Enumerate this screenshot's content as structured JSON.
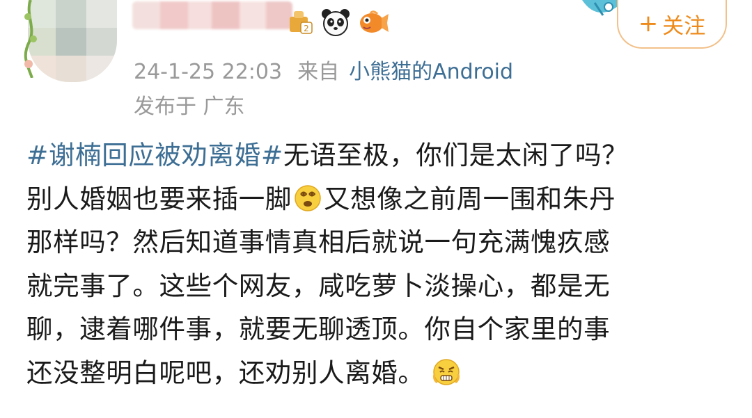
{
  "header": {
    "follow_button": {
      "plus": "+",
      "label": "关注"
    },
    "badges": [
      {
        "icon": "level-badge-icon"
      },
      {
        "icon": "panda-icon"
      },
      {
        "icon": "goldfish-icon"
      }
    ]
  },
  "meta": {
    "timestamp": "24-1-25 22:03",
    "from_label": "来自",
    "source": "小熊猫的Android",
    "location": "发布于 广东"
  },
  "post": {
    "hashtag": "#谢楠回应被劝离婚#",
    "line1_rest": "无语至极，你们是太闲了吗？",
    "line2_a": "别人婚姻也要来插一脚",
    "line2_b": "又想像之前周一围和朱丹",
    "line3": "那样吗？然后知道事情真相后就说一句充满愧疚感",
    "line4": "就完事了。这些个网友，咸吃萝卜淡操心，都是无",
    "line5": "聊，逮着哪件事，就要无聊透顶。你自个家里的事",
    "line6": "还没整明白呢吧，还劝别人离婚。",
    "emojis": [
      "dizzy-face-emoji",
      "grimace-face-emoji"
    ]
  },
  "colors": {
    "link": "#3d6e94",
    "meta_gray": "#999999",
    "follow_orange": "#ee8a1a",
    "text": "#1a1a1a"
  }
}
